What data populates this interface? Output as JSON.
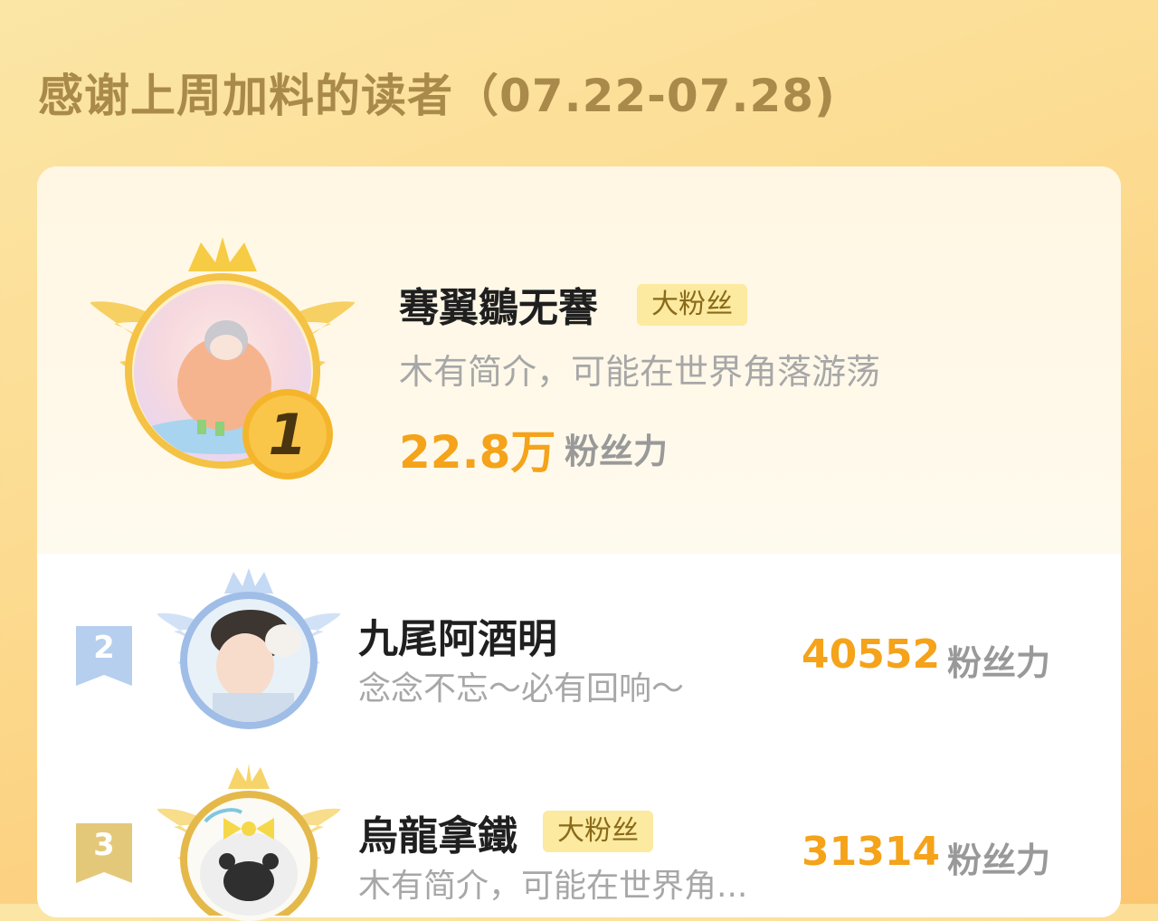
{
  "header": {
    "title": "感谢上周加料的读者（07.22-07.28)"
  },
  "readers": [
    {
      "rank": "1",
      "name": "骞翼鶵无謇",
      "badge": "大粉丝",
      "bio": "木有简介，可能在世界角落游荡",
      "score": "22.8万",
      "score_label": "粉丝力"
    },
    {
      "rank": "2",
      "name": "九尾阿酒明",
      "badge": "",
      "bio": "念念不忘～必有回响～",
      "score": "40552",
      "score_label": "粉丝力"
    },
    {
      "rank": "3",
      "name": "烏龍拿鐵",
      "badge": "大粉丝",
      "bio": "木有简介，可能在世界角...",
      "score": "31314",
      "score_label": "粉丝力"
    }
  ],
  "colors": {
    "accent": "#f4a31a",
    "gold": "#f2b42a",
    "badge_bg": "#fbeaa0",
    "silver": "#a9c6ea"
  }
}
